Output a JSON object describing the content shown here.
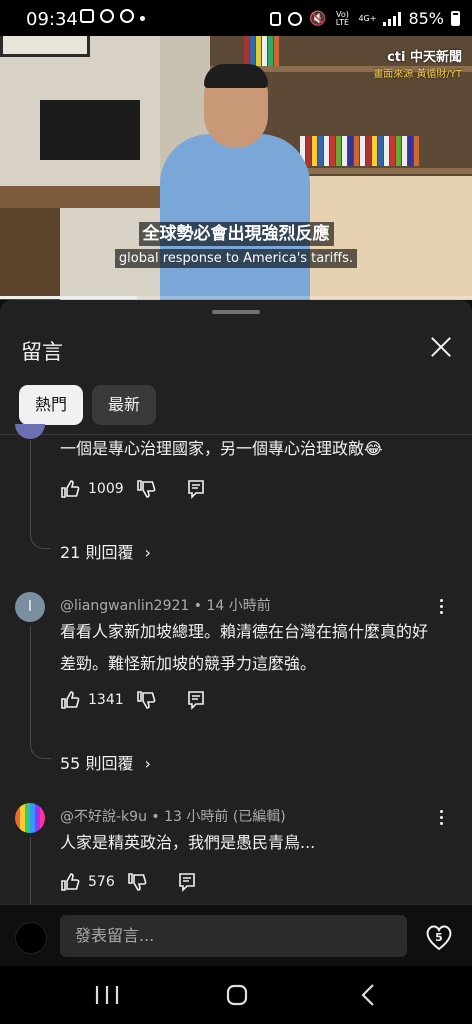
{
  "status": {
    "time": "09:34",
    "network_label": "Vo) LTE",
    "network_gen": "4G+",
    "battery": "85%"
  },
  "video": {
    "watermark_logo": "cti 中天新聞",
    "watermark_source": "畫面來源 黃循財/YT",
    "caption_zh": "全球勢必會出現強烈反應",
    "caption_en": "global response to America's tariffs.",
    "progress_fraction": 0.29
  },
  "sheet": {
    "title": "留言",
    "tabs": [
      {
        "label": "熱門",
        "active": true
      },
      {
        "label": "最新",
        "active": false
      }
    ]
  },
  "comments": [
    {
      "text": "一個是專心治理國家，另一個專心治理政敵😂",
      "likes": "1009",
      "replies": "21 則回覆"
    },
    {
      "author": "@liangwanlin2921",
      "time": "14 小時前",
      "avatar_letter": "l",
      "text_line1": "看看人家新加坡總理。賴清德在台灣在搞什麼真的好",
      "text_line2": "差勁。難怪新加坡的競爭力這麼強。",
      "likes": "1341",
      "replies": "55 則回覆"
    },
    {
      "author": "@不好說-k9u",
      "time": "13 小時前 (已編輯)",
      "text": "人家是精英政治，我們是愚民青鳥...",
      "likes": "576"
    }
  ],
  "composer": {
    "placeholder": "發表留言...",
    "heart_count": "5"
  },
  "icons": [
    "image-icon",
    "youtube-icon",
    "facebook-icon",
    "alarm-icon",
    "mute-icon",
    "signal-icon",
    "battery-icon",
    "close-icon",
    "thumbs-up-icon",
    "thumbs-down-icon",
    "reply-icon",
    "chevron-right-icon",
    "more-vert-icon",
    "heart-icon",
    "recent-apps-icon",
    "home-icon",
    "back-icon"
  ]
}
